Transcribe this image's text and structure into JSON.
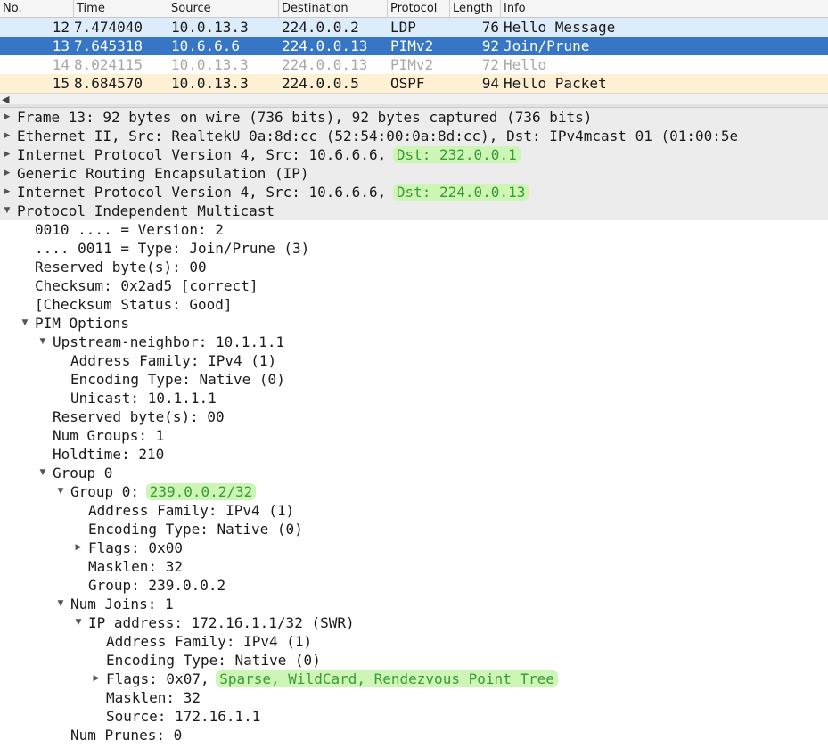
{
  "packet_list": {
    "columns": [
      "No.",
      "Time",
      "Source",
      "Destination",
      "Protocol",
      "Length",
      "Info"
    ],
    "rows": [
      {
        "no": "12",
        "time": "7.474040",
        "source": "10.0.13.3",
        "destination": "224.0.0.2",
        "protocol": "LDP",
        "length": "76",
        "info": "Hello Message"
      },
      {
        "no": "13",
        "time": "7.645318",
        "source": "10.6.6.6",
        "destination": "224.0.0.13",
        "protocol": "PIMv2",
        "length": "92",
        "info": "Join/Prune"
      },
      {
        "no": "14",
        "time": "8.024115",
        "source": "10.0.13.3",
        "destination": "224.0.0.13",
        "protocol": "PIMv2",
        "length": "72",
        "info": "Hello"
      },
      {
        "no": "15",
        "time": "8.684570",
        "source": "10.0.13.3",
        "destination": "224.0.0.5",
        "protocol": "OSPF",
        "length": "94",
        "info": "Hello Packet"
      }
    ]
  },
  "details": {
    "frame": "Frame 13: 92 bytes on wire (736 bits), 92 bytes captured (736 bits)",
    "ethernet": "Ethernet II, Src: RealtekU_0a:8d:cc (52:54:00:0a:8d:cc), Dst: IPv4mcast_01 (01:00:5e",
    "ip_outer": "Internet Protocol Version 4, Src: 10.6.6.6, ",
    "ip_outer_dst": "Dst: 232.0.0.1",
    "gre": "Generic Routing Encapsulation (IP)",
    "ip_inner": "Internet Protocol Version 4, Src: 10.6.6.6, ",
    "ip_inner_dst": "Dst: 224.0.0.13",
    "pim": "Protocol Independent Multicast",
    "version": "0010 .... = Version: 2",
    "type": ".... 0011 = Type: Join/Prune (3)",
    "reserved": "Reserved byte(s): 00",
    "checksum": "Checksum: 0x2ad5 [correct]",
    "checksum_status": "[Checksum Status: Good]",
    "pim_options": "PIM Options",
    "upstream": "Upstream-neighbor: 10.1.1.1",
    "up_af": "Address Family: IPv4 (1)",
    "up_enc": "Encoding Type: Native (0)",
    "up_unicast": "Unicast: 10.1.1.1",
    "opt_reserved": "Reserved byte(s): 00",
    "num_groups": "Num Groups: 1",
    "holdtime": "Holdtime: 210",
    "group0": "Group 0",
    "group0_sub": "Group 0: ",
    "group0_addr": "239.0.0.2/32",
    "g_af": "Address Family: IPv4 (1)",
    "g_enc": "Encoding Type: Native (0)",
    "g_flags": "Flags: 0x00",
    "g_masklen": "Masklen: 32",
    "g_group": "Group: 239.0.0.2",
    "num_joins": "Num Joins: 1",
    "ip_address": "IP address: 172.16.1.1/32 (SWR)",
    "j_af": "Address Family: IPv4 (1)",
    "j_enc": "Encoding Type: Native (0)",
    "j_flags": "Flags: 0x07, ",
    "j_flags_hl": "Sparse, WildCard, Rendezvous Point Tree",
    "j_masklen": "Masklen: 32",
    "j_source": "Source: 172.16.1.1",
    "num_prunes": "Num Prunes: 0"
  }
}
